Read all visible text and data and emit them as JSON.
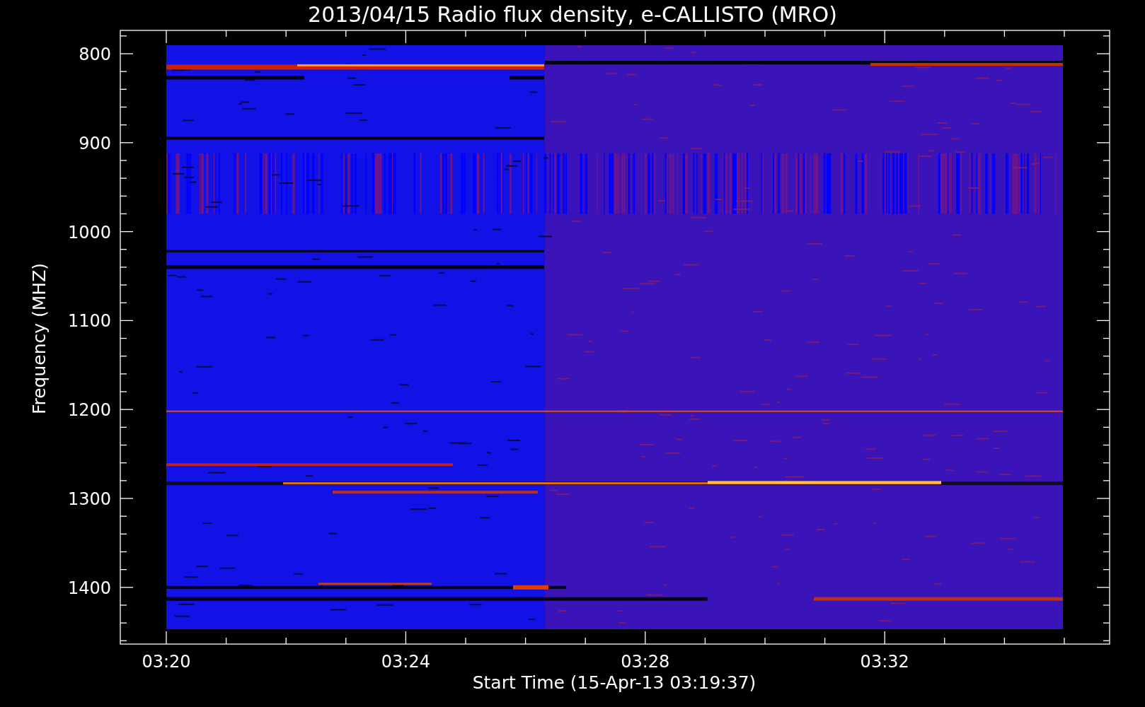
{
  "plot": {
    "title": "2013/04/15  Radio flux density, e-CALLISTO (MRO)",
    "ylabel": "Frequency (MHZ)",
    "yticks": [
      "800",
      "900",
      "1000",
      "1100",
      "1200",
      "1300",
      "1400"
    ],
    "xlabel": "Start Time (15-Apr-13 03:19:37)",
    "xticks": [
      "03:20",
      "03:24",
      "03:28",
      "03:32"
    ]
  }
}
